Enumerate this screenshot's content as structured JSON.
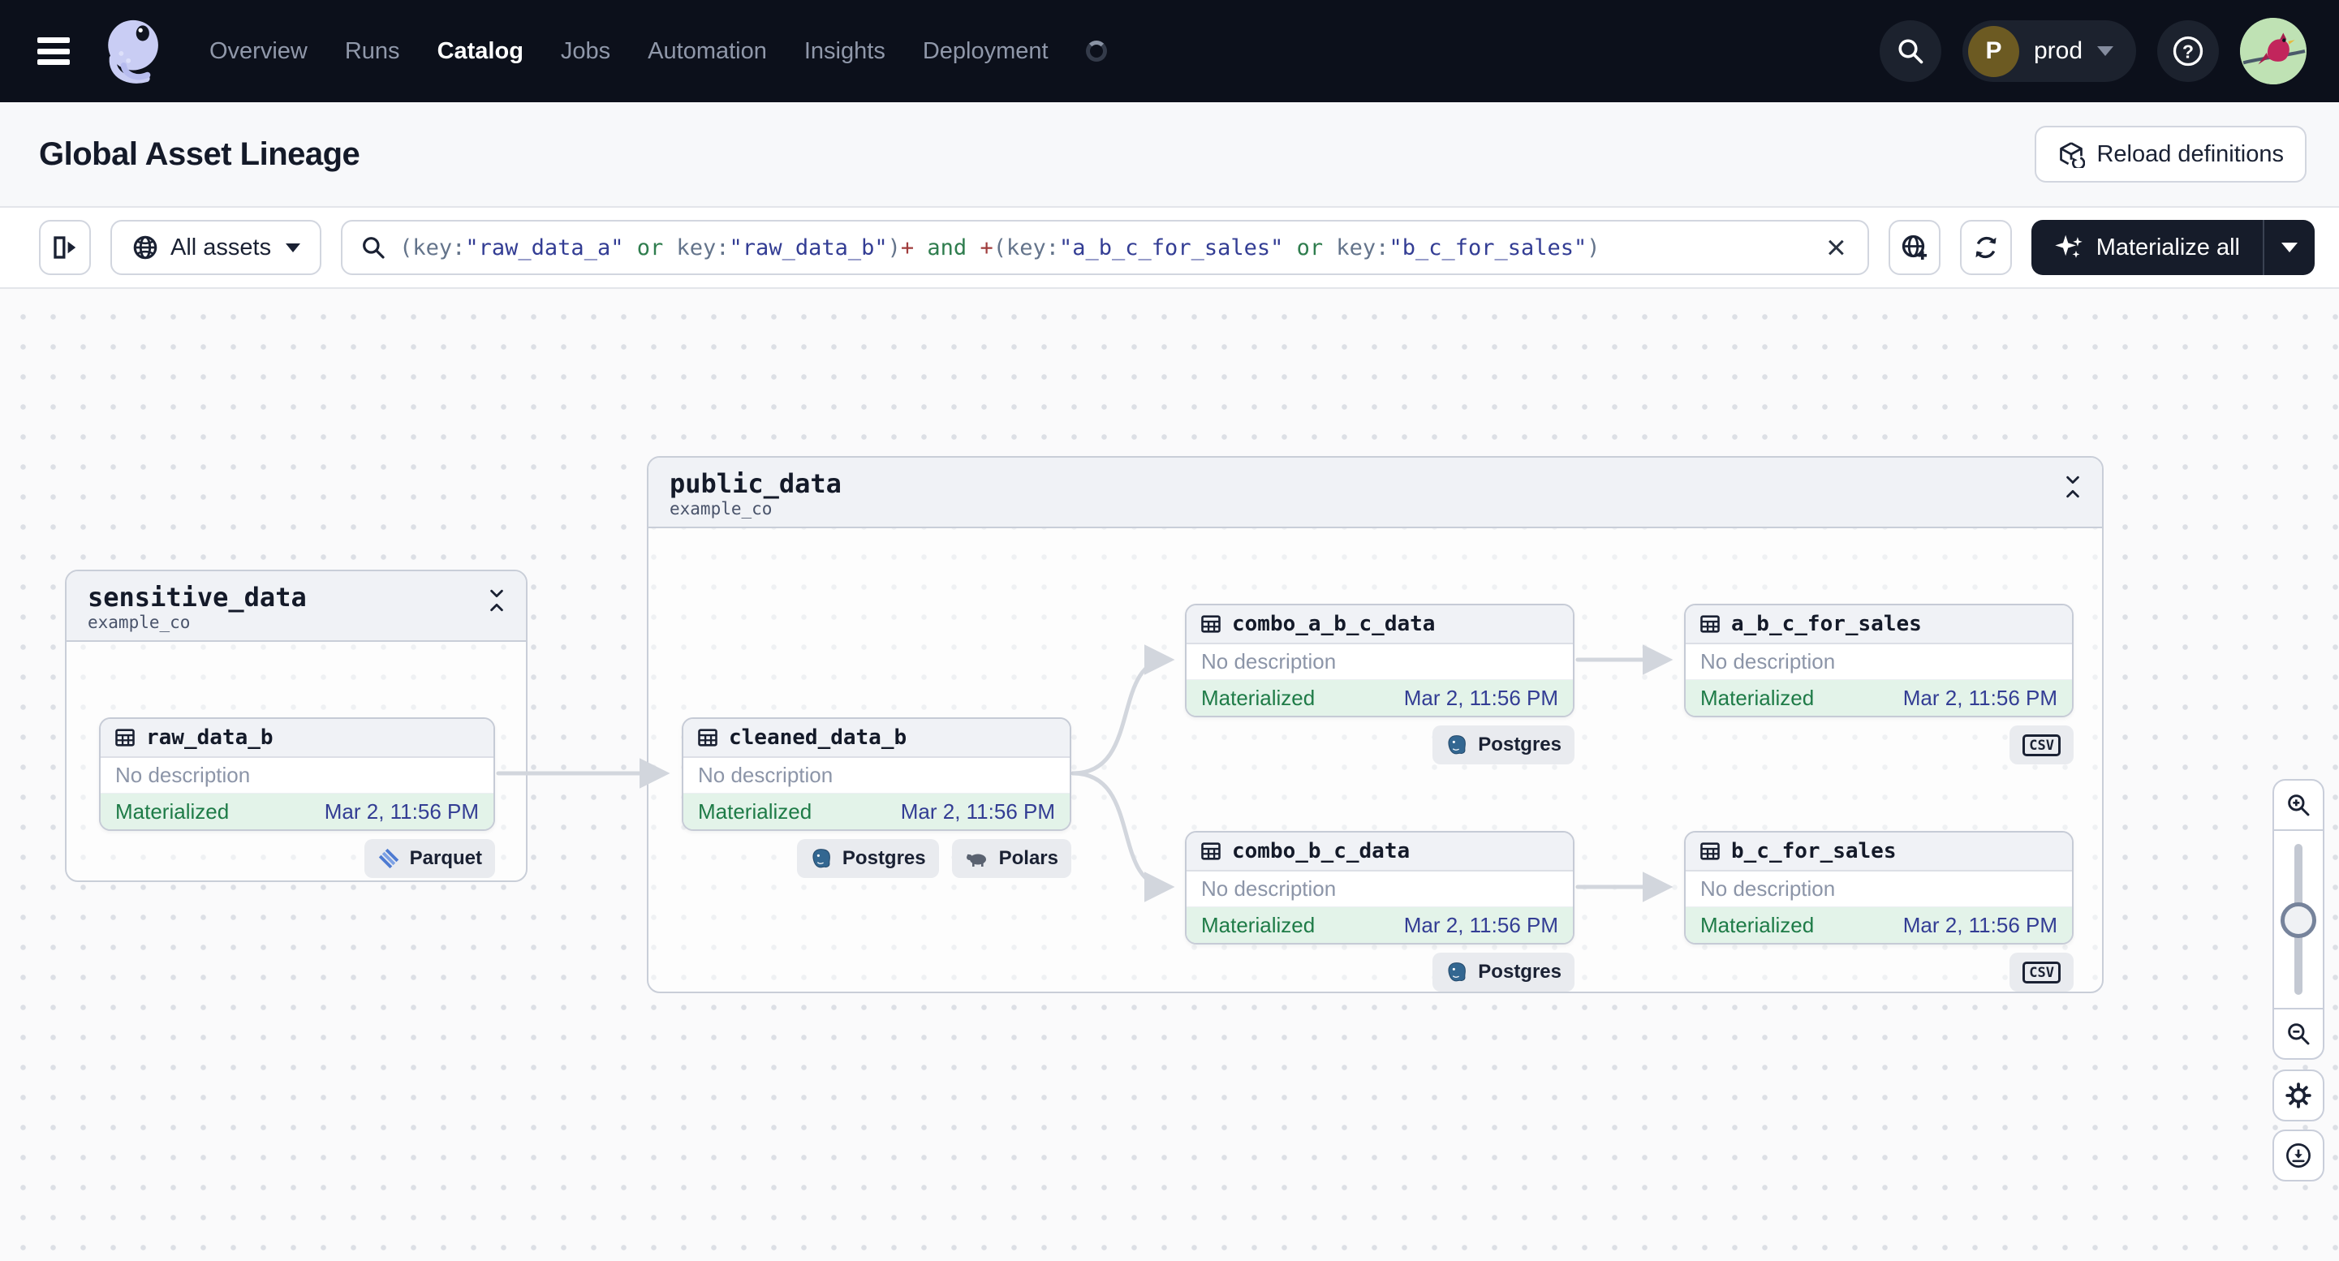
{
  "nav": {
    "items": [
      {
        "label": "Overview",
        "active": false
      },
      {
        "label": "Runs",
        "active": false
      },
      {
        "label": "Catalog",
        "active": true
      },
      {
        "label": "Jobs",
        "active": false
      },
      {
        "label": "Automation",
        "active": false
      },
      {
        "label": "Insights",
        "active": false
      },
      {
        "label": "Deployment",
        "active": false
      }
    ],
    "environment": {
      "initial": "P",
      "name": "prod"
    }
  },
  "page_header": {
    "title": "Global Asset Lineage",
    "reload_button_label": "Reload definitions"
  },
  "toolbar": {
    "scope_button_label": "All assets",
    "materialize_button_label": "Materialize all",
    "query": {
      "full_text": "(key:\"raw_data_a\" or key:\"raw_data_b\")+ and +(key:\"a_b_c_for_sales\" or key:\"b_c_for_sales\")",
      "segments": [
        {
          "text": "(key:",
          "style": "punct"
        },
        {
          "text": "\"raw_data_a\"",
          "style": "string"
        },
        {
          "text": " ",
          "style": "punct"
        },
        {
          "text": "or",
          "style": "operator"
        },
        {
          "text": " ",
          "style": "punct"
        },
        {
          "text": "key:",
          "style": "punct"
        },
        {
          "text": "\"raw_data_b\"",
          "style": "string"
        },
        {
          "text": ")",
          "style": "punct"
        },
        {
          "text": "+",
          "style": "plus"
        },
        {
          "text": " ",
          "style": "punct"
        },
        {
          "text": "and",
          "style": "operator"
        },
        {
          "text": " ",
          "style": "punct"
        },
        {
          "text": "+",
          "style": "plus"
        },
        {
          "text": "(key:",
          "style": "punct"
        },
        {
          "text": "\"a_b_c_for_sales\"",
          "style": "string"
        },
        {
          "text": " ",
          "style": "punct"
        },
        {
          "text": "or",
          "style": "operator"
        },
        {
          "text": " ",
          "style": "punct"
        },
        {
          "text": "key:",
          "style": "punct"
        },
        {
          "text": "\"b_c_for_sales\"",
          "style": "string"
        },
        {
          "text": ")",
          "style": "punct"
        }
      ]
    }
  },
  "graph": {
    "groups": [
      {
        "name": "sensitive_data",
        "repository": "example_co"
      },
      {
        "name": "public_data",
        "repository": "example_co"
      }
    ],
    "nodes": [
      {
        "name": "raw_data_b",
        "description": "No description",
        "status": "Materialized",
        "timestamp": "Mar 2, 11:56 PM"
      },
      {
        "name": "cleaned_data_b",
        "description": "No description",
        "status": "Materialized",
        "timestamp": "Mar 2, 11:56 PM"
      },
      {
        "name": "combo_a_b_c_data",
        "description": "No description",
        "status": "Materialized",
        "timestamp": "Mar 2, 11:56 PM"
      },
      {
        "name": "a_b_c_for_sales",
        "description": "No description",
        "status": "Materialized",
        "timestamp": "Mar 2, 11:56 PM"
      },
      {
        "name": "combo_b_c_data",
        "description": "No description",
        "status": "Materialized",
        "timestamp": "Mar 2, 11:56 PM"
      },
      {
        "name": "b_c_for_sales",
        "description": "No description",
        "status": "Materialized",
        "timestamp": "Mar 2, 11:56 PM"
      }
    ],
    "tags": [
      {
        "label": "Parquet",
        "icon": "parquet"
      },
      {
        "label": "Postgres",
        "icon": "postgres"
      },
      {
        "label": "Polars",
        "icon": "polars"
      },
      {
        "label": "Postgres",
        "icon": "postgres"
      },
      {
        "label": "CSV",
        "icon": "csv"
      },
      {
        "label": "Postgres",
        "icon": "postgres"
      },
      {
        "label": "CSV",
        "icon": "csv"
      }
    ]
  },
  "colors": {
    "nav_background": "#0C101B",
    "accent_dark_button": "#161C2A",
    "status_materialized_text": "#1E7B47",
    "status_materialized_background": "#E3F3E9",
    "timestamp_text": "#333D94",
    "edge_gray": "#D2D6DD",
    "syntax_punctuation": "#64748B",
    "syntax_string": "#333D94",
    "syntax_operator": "#2F7D4E",
    "syntax_plus": "#A03C3C",
    "postgres_blue": "#336791",
    "parquet_blue": "#4E7BD2"
  }
}
